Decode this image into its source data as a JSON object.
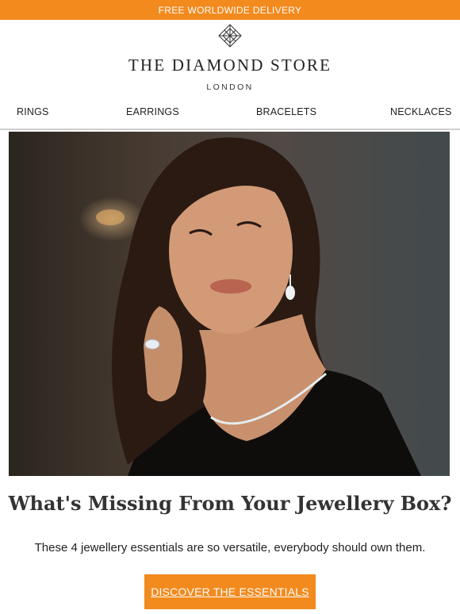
{
  "topbar": {
    "text": "FREE WORLDWIDE DELIVERY"
  },
  "logo": {
    "icon": "diamond-icon",
    "brand": "THE DIAMOND STORE",
    "city": "LONDON"
  },
  "nav": {
    "items": [
      "RINGS",
      "EARRINGS",
      "BRACELETS",
      "NECKLACES"
    ]
  },
  "hero": {
    "image": "woman-wearing-diamond-jewellery-photo"
  },
  "content": {
    "headline": "What's Missing From Your Jewellery Box?",
    "subtext": "These 4 jewellery essentials are so versatile, everybody should own them.",
    "cta_label": "DISCOVER THE ESSENTIALS"
  },
  "colors": {
    "accent": "#f28a1e",
    "text": "#222222",
    "divider": "#cfcfcf"
  }
}
